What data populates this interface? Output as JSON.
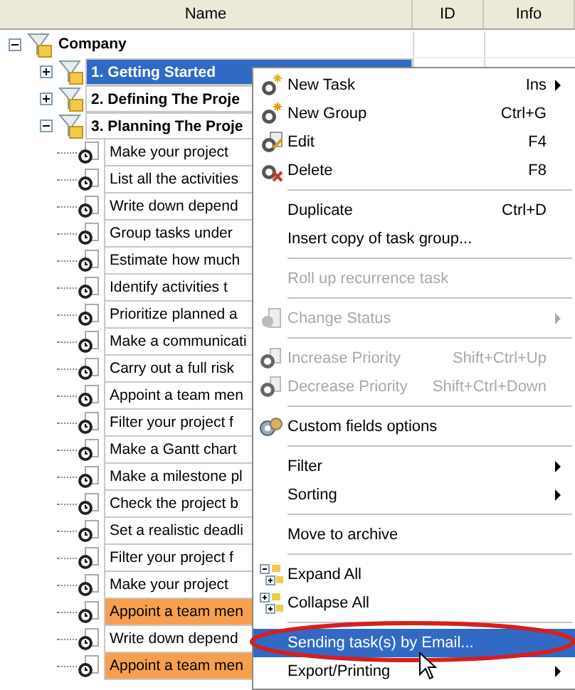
{
  "columns": [
    {
      "label": "Name"
    },
    {
      "label": "ID"
    },
    {
      "label": "Info"
    }
  ],
  "tree": {
    "label": "Company",
    "expanded": true,
    "children": [
      {
        "label": "1. Getting Started",
        "expanded": false,
        "selected": true
      },
      {
        "label": "2. Defining The Proje",
        "expanded": false,
        "selected": false
      },
      {
        "label": "3. Planning The Proje",
        "expanded": true,
        "selected": false,
        "children": [
          {
            "label": "Make your project",
            "highlighted": false
          },
          {
            "label": "List all the activities",
            "highlighted": false
          },
          {
            "label": "Write down depend",
            "highlighted": false
          },
          {
            "label": "Group tasks under",
            "highlighted": false
          },
          {
            "label": "Estimate how much",
            "highlighted": false
          },
          {
            "label": "Identify activities t",
            "highlighted": false
          },
          {
            "label": "Prioritize planned a",
            "highlighted": false
          },
          {
            "label": "Make a communicati",
            "highlighted": false
          },
          {
            "label": "Carry out a full risk",
            "highlighted": false
          },
          {
            "label": "Appoint a team men",
            "highlighted": false
          },
          {
            "label": "Filter your project f",
            "highlighted": false
          },
          {
            "label": "Make a Gantt chart",
            "highlighted": false
          },
          {
            "label": "Make a milestone pl",
            "highlighted": false
          },
          {
            "label": "Check the project b",
            "highlighted": false
          },
          {
            "label": "Set a realistic deadli",
            "highlighted": false
          },
          {
            "label": "Filter your project f",
            "highlighted": false
          },
          {
            "label": "Make your project",
            "highlighted": false
          },
          {
            "label": "Appoint a team men",
            "highlighted": true
          },
          {
            "label": "Write down depend",
            "highlighted": false
          },
          {
            "label": "Appoint a team men",
            "highlighted": true
          }
        ]
      }
    ]
  },
  "context_menu": [
    {
      "kind": "new-task",
      "label": "New Task",
      "shortcut": "Ins",
      "submenu": true,
      "disabled": false,
      "selected": false
    },
    {
      "kind": "new-group",
      "label": "New Group",
      "shortcut": "Ctrl+G",
      "submenu": false,
      "disabled": false,
      "selected": false
    },
    {
      "kind": "edit",
      "label": "Edit",
      "shortcut": "F4",
      "submenu": false,
      "disabled": false,
      "selected": false
    },
    {
      "kind": "delete",
      "label": "Delete",
      "shortcut": "F8",
      "submenu": false,
      "disabled": false,
      "selected": false
    },
    {
      "kind": "separator"
    },
    {
      "kind": "plain",
      "label": "Duplicate",
      "shortcut": "Ctrl+D",
      "submenu": false,
      "disabled": false,
      "selected": false
    },
    {
      "kind": "plain",
      "label": "Insert copy of task group...",
      "submenu": false,
      "disabled": false,
      "selected": false
    },
    {
      "kind": "separator"
    },
    {
      "kind": "plain",
      "label": "Roll up recurrence task",
      "submenu": false,
      "disabled": true,
      "selected": false
    },
    {
      "kind": "separator"
    },
    {
      "kind": "status",
      "label": "Change Status",
      "submenu": true,
      "disabled": true,
      "selected": false
    },
    {
      "kind": "separator"
    },
    {
      "kind": "priority",
      "label": "Increase Priority",
      "shortcut": "Shift+Ctrl+Up",
      "submenu": false,
      "disabled": true,
      "selected": false
    },
    {
      "kind": "priority",
      "label": "Decrease Priority",
      "shortcut": "Shift+Ctrl+Down",
      "submenu": false,
      "disabled": true,
      "selected": false
    },
    {
      "kind": "separator"
    },
    {
      "kind": "custom-fields",
      "label": "Custom fields options",
      "submenu": false,
      "disabled": false,
      "selected": false
    },
    {
      "kind": "separator"
    },
    {
      "kind": "plain",
      "label": "Filter",
      "submenu": true,
      "disabled": false,
      "selected": false
    },
    {
      "kind": "plain",
      "label": "Sorting",
      "submenu": true,
      "disabled": false,
      "selected": false
    },
    {
      "kind": "separator"
    },
    {
      "kind": "plain",
      "label": "Move to archive",
      "submenu": false,
      "disabled": false,
      "selected": false
    },
    {
      "kind": "separator"
    },
    {
      "kind": "expand",
      "label": "Expand All",
      "submenu": false,
      "disabled": false,
      "selected": false
    },
    {
      "kind": "collapse",
      "label": "Collapse All",
      "submenu": false,
      "disabled": false,
      "selected": false
    },
    {
      "kind": "separator"
    },
    {
      "kind": "plain",
      "label": "Sending task(s) by Email...",
      "submenu": false,
      "disabled": false,
      "selected": true
    },
    {
      "kind": "plain",
      "label": "Export/Printing",
      "submenu": true,
      "disabled": false,
      "selected": false
    }
  ]
}
